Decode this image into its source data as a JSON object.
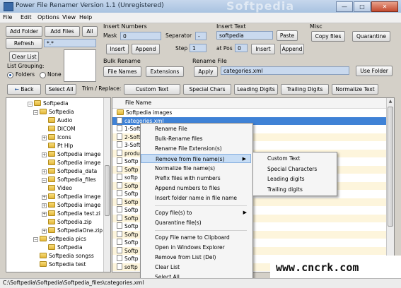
{
  "window": {
    "title": "Power File Renamer Version 1.1 (Unregistered)",
    "watermark": "Softpedia",
    "minimize": "—",
    "maximize": "□",
    "close": "✕"
  },
  "menu": [
    "File",
    "Edit",
    "Options",
    "View",
    "Help"
  ],
  "buttons": {
    "add_folder": "Add Folder",
    "add_files": "Add Files",
    "all": "All",
    "refresh": "Refresh",
    "clear_list": "Clear List",
    "back": "Back",
    "select_all": "Select All",
    "insert_numbers_insert": "Insert",
    "insert_numbers_append": "Append",
    "paste": "Paste",
    "insert_text_insert": "Insert",
    "insert_text_append": "Append",
    "copy_files": "Copy files",
    "quarantine": "Quarantine",
    "file_names": "File Names",
    "extensions": "Extensions",
    "apply": "Apply",
    "use_folder": "Use Folder"
  },
  "filter_value": "*.*",
  "list_grouping": {
    "label": "List Grouping:",
    "folders": "Folders",
    "none": "None",
    "selected": "folders"
  },
  "insert_numbers": {
    "title": "Insert Numbers",
    "mask_label": "Mask",
    "mask_value": "0",
    "separator_label": "Separator",
    "separator_value": "-",
    "step_label": "Step",
    "step_value": "1"
  },
  "insert_text": {
    "title": "Insert Text",
    "text_value": "softpedia",
    "at_pos_label": "at Pos",
    "at_pos_value": "0"
  },
  "misc": {
    "title": "Misc"
  },
  "bulk_rename": {
    "title": "Bulk Rename"
  },
  "rename_file": {
    "title": "Rename File",
    "value": "categories.xml"
  },
  "trim": {
    "label": "Trim / Replace:",
    "buttons": [
      "Custom Text",
      "Special Chars",
      "Leading Digits",
      "Trailing Digits",
      "Normalize Text"
    ]
  },
  "tree": [
    {
      "label": "Softpedia",
      "depth": 0,
      "expander": "−"
    },
    {
      "label": "Softpedia",
      "depth": 1,
      "expander": "−"
    },
    {
      "label": "Audio",
      "depth": 2,
      "expander": ""
    },
    {
      "label": "DICOM",
      "depth": 2,
      "expander": ""
    },
    {
      "label": "Icons",
      "depth": 2,
      "expander": "+"
    },
    {
      "label": "Pt Hlp",
      "depth": 2,
      "expander": ""
    },
    {
      "label": "Softpedia image",
      "depth": 2,
      "expander": "+"
    },
    {
      "label": "Softpedia image",
      "depth": 2,
      "expander": ""
    },
    {
      "label": "Softpedia_data",
      "depth": 2,
      "expander": "+"
    },
    {
      "label": "Softpedia_files",
      "depth": 2,
      "expander": "−"
    },
    {
      "label": "Video",
      "depth": 2,
      "expander": ""
    },
    {
      "label": "Softpedia image",
      "depth": 2,
      "expander": "+"
    },
    {
      "label": "Softpedia image",
      "depth": 2,
      "expander": "+"
    },
    {
      "label": "Softpedia test.zi",
      "depth": 2,
      "expander": "+"
    },
    {
      "label": "Softpedia.zip",
      "depth": 2,
      "expander": ""
    },
    {
      "label": "SoftpediaOne.zip",
      "depth": 2,
      "expander": "+"
    },
    {
      "label": "Softpedia pics",
      "depth": 1,
      "expander": "−"
    },
    {
      "label": "Softpedia",
      "depth": 2,
      "expander": ""
    },
    {
      "label": "Softpedia songss",
      "depth": 1,
      "expander": ""
    },
    {
      "label": "Softpedia test",
      "depth": 1,
      "expander": ""
    }
  ],
  "file_list": {
    "header": "File Name",
    "rows": [
      {
        "name": "Softpedia images",
        "folder": true,
        "selected": false
      },
      {
        "name": "categories.xml",
        "folder": false,
        "selected": true
      },
      {
        "name": "1-Soft",
        "folder": false,
        "selected": false
      },
      {
        "name": "2-Soft",
        "folder": false,
        "selected": false
      },
      {
        "name": "3-Soft",
        "folder": false,
        "selected": false
      },
      {
        "name": "produ",
        "folder": false,
        "selected": false
      },
      {
        "name": "Softp",
        "folder": false,
        "selected": false
      },
      {
        "name": "Softp",
        "folder": false,
        "selected": false
      },
      {
        "name": "softp",
        "folder": false,
        "selected": false
      },
      {
        "name": "Softp",
        "folder": false,
        "selected": false
      },
      {
        "name": "Softp",
        "folder": false,
        "selected": false
      },
      {
        "name": "Softp",
        "folder": false,
        "selected": false
      },
      {
        "name": "Softp",
        "folder": false,
        "selected": false
      },
      {
        "name": "Softp",
        "folder": false,
        "selected": false
      },
      {
        "name": "Softp",
        "folder": false,
        "selected": false
      },
      {
        "name": "Softp",
        "folder": false,
        "selected": false
      },
      {
        "name": "Softp",
        "folder": false,
        "selected": false
      },
      {
        "name": "Softp",
        "folder": false,
        "selected": false
      },
      {
        "name": "Softp",
        "folder": false,
        "selected": false
      },
      {
        "name": "softp",
        "folder": false,
        "selected": false
      }
    ]
  },
  "context_menu": [
    "Rename File",
    "Bulk-Rename files",
    "Rename File Extension(s)",
    "Remove from file name(s)",
    "Normalize file name(s)",
    "Prefix files with numbers",
    "Append numbers to files",
    "Insert folder name in file name",
    "Copy file(s) to",
    "Quarantine file(s)",
    "Copy File name to Clipboard",
    "Open in Windows Explorer",
    "Remove from List (Del)",
    "Clear List",
    "Select All"
  ],
  "submenu": [
    "Custom Text",
    "Special Characters",
    "Leading digits",
    "Trailing digits"
  ],
  "status_path": "C:\\Softpedia\\Softpedia\\Softpedia_files\\categories.xml",
  "site_watermark": "www.cncrk.com"
}
